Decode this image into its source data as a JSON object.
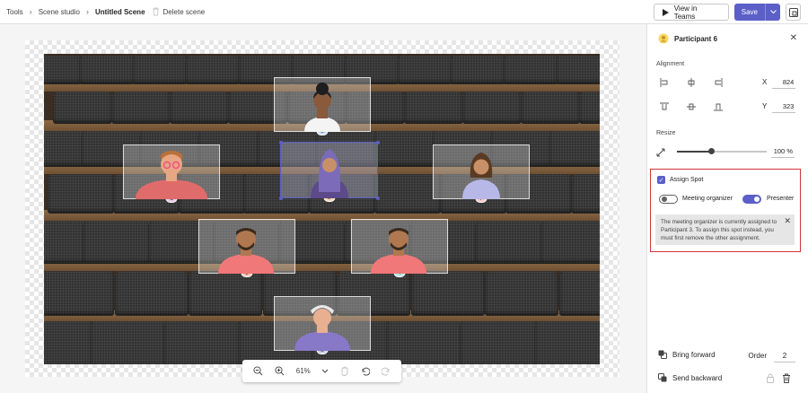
{
  "breadcrumb": {
    "tools": "Tools",
    "scene_studio": "Scene studio",
    "current": "Untitled Scene",
    "delete": "Delete scene"
  },
  "toolbar": {
    "view_in_teams": "View in Teams",
    "save": "Save"
  },
  "spots": [
    {
      "number": "1",
      "color": "#e8c8e8"
    },
    {
      "number": "2",
      "color": "#c8d0f0"
    },
    {
      "number": "3",
      "color": "#c8e0f8"
    },
    {
      "number": "4",
      "color": "#b8ecec"
    },
    {
      "number": "5",
      "color": "#f8c8b8"
    },
    {
      "number": "6",
      "color": "#f8d8b0"
    },
    {
      "number": "7",
      "color": "#f8c8c8"
    }
  ],
  "zoom": {
    "level": "61%"
  },
  "panel": {
    "title": "Participant  6",
    "alignment_label": "Alignment",
    "x_label": "X",
    "x_value": "824",
    "y_label": "Y",
    "y_value": "323",
    "resize_label": "Resize",
    "resize_value": "100 %",
    "resize_fraction": 0.38,
    "assign_spot": "Assign Spot",
    "meeting_organizer": "Meeting organizer",
    "presenter": "Presenter",
    "message": "The meeting organizer is currently assigned to Participant 3. To assign this spot instead, you must first remove the other assignment.",
    "bring_forward": "Bring forward",
    "send_backward": "Send backward",
    "order_label": "Order",
    "order_value": "2"
  },
  "colors": {
    "accent": "#5b5fc7",
    "highlight": "#d13438"
  }
}
